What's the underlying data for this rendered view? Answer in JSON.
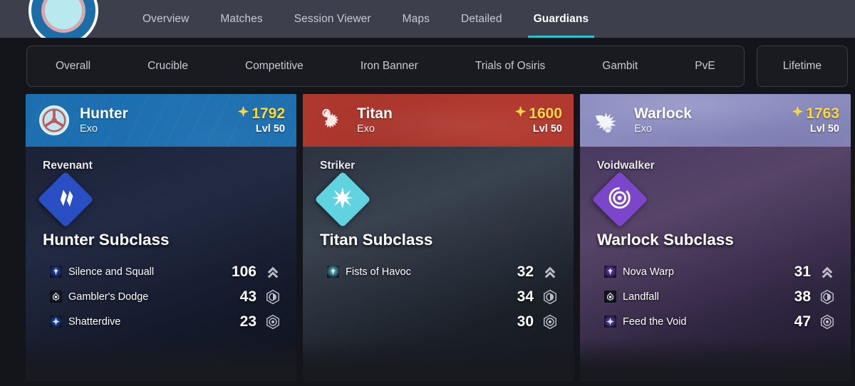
{
  "nav": {
    "avatar_name": "player-avatar",
    "tabs": [
      {
        "label": "Overview",
        "active": false
      },
      {
        "label": "Matches",
        "active": false
      },
      {
        "label": "Session Viewer",
        "active": false
      },
      {
        "label": "Maps",
        "active": false
      },
      {
        "label": "Detailed",
        "active": false
      },
      {
        "label": "Guardians",
        "active": true
      }
    ],
    "accent_color": "#2fc3c9"
  },
  "filters": {
    "primary": [
      "Overall",
      "Crucible",
      "Competitive",
      "Iron Banner",
      "Trials of Osiris",
      "Gambit",
      "PvE"
    ],
    "secondary": [
      "Lifetime"
    ]
  },
  "guardians": [
    {
      "class_name": "Hunter",
      "race": "Exo",
      "power": "1792",
      "level": "Lvl 50",
      "header_color": "#1c6fb0",
      "emblem_icon": "hunter-emblem-icon",
      "subclass_name": "Revenant",
      "subclass_title": "Hunter Subclass",
      "subclass_color": "#2a4fc4",
      "subclass_icon": "stasis-revenant-icon",
      "abilities": [
        {
          "name": "Silence and Squall",
          "icon": "super-ability-icon",
          "value": "106",
          "stat_icon": "super-chevron-icon"
        },
        {
          "name": "Gambler's Dodge",
          "icon": "class-ability-icon",
          "value": "43",
          "stat_icon": "melee-hex-icon"
        },
        {
          "name": "Shatterdive",
          "icon": "movement-ability-icon",
          "value": "23",
          "stat_icon": "grenade-hex-icon"
        }
      ]
    },
    {
      "class_name": "Titan",
      "race": "Exo",
      "power": "1600",
      "level": "Lvl 50",
      "header_color": "#b2392f",
      "emblem_icon": "titan-emblem-icon",
      "subclass_name": "Striker",
      "subclass_title": "Titan Subclass",
      "subclass_color": "#5fd3e0",
      "subclass_icon": "arc-striker-icon",
      "abilities": [
        {
          "name": "Fists of Havoc",
          "icon": "super-ability-icon",
          "value": "32",
          "stat_icon": "super-chevron-icon"
        },
        {
          "name": "",
          "icon": "",
          "value": "34",
          "stat_icon": "melee-hex-icon"
        },
        {
          "name": "",
          "icon": "",
          "value": "30",
          "stat_icon": "grenade-hex-icon"
        }
      ]
    },
    {
      "class_name": "Warlock",
      "race": "Exo",
      "power": "1763",
      "level": "Lvl 50",
      "header_color": "#8a8cc0",
      "emblem_icon": "warlock-emblem-icon",
      "subclass_name": "Voidwalker",
      "subclass_title": "Warlock Subclass",
      "subclass_color": "#7b46c9",
      "subclass_icon": "void-voidwalker-icon",
      "abilities": [
        {
          "name": "Nova Warp",
          "icon": "super-ability-icon",
          "value": "31",
          "stat_icon": "super-chevron-icon"
        },
        {
          "name": "Landfall",
          "icon": "class-ability-icon",
          "value": "38",
          "stat_icon": "melee-hex-icon"
        },
        {
          "name": "Feed the Void",
          "icon": "movement-ability-icon",
          "value": "47",
          "stat_icon": "grenade-hex-icon"
        }
      ]
    }
  ]
}
